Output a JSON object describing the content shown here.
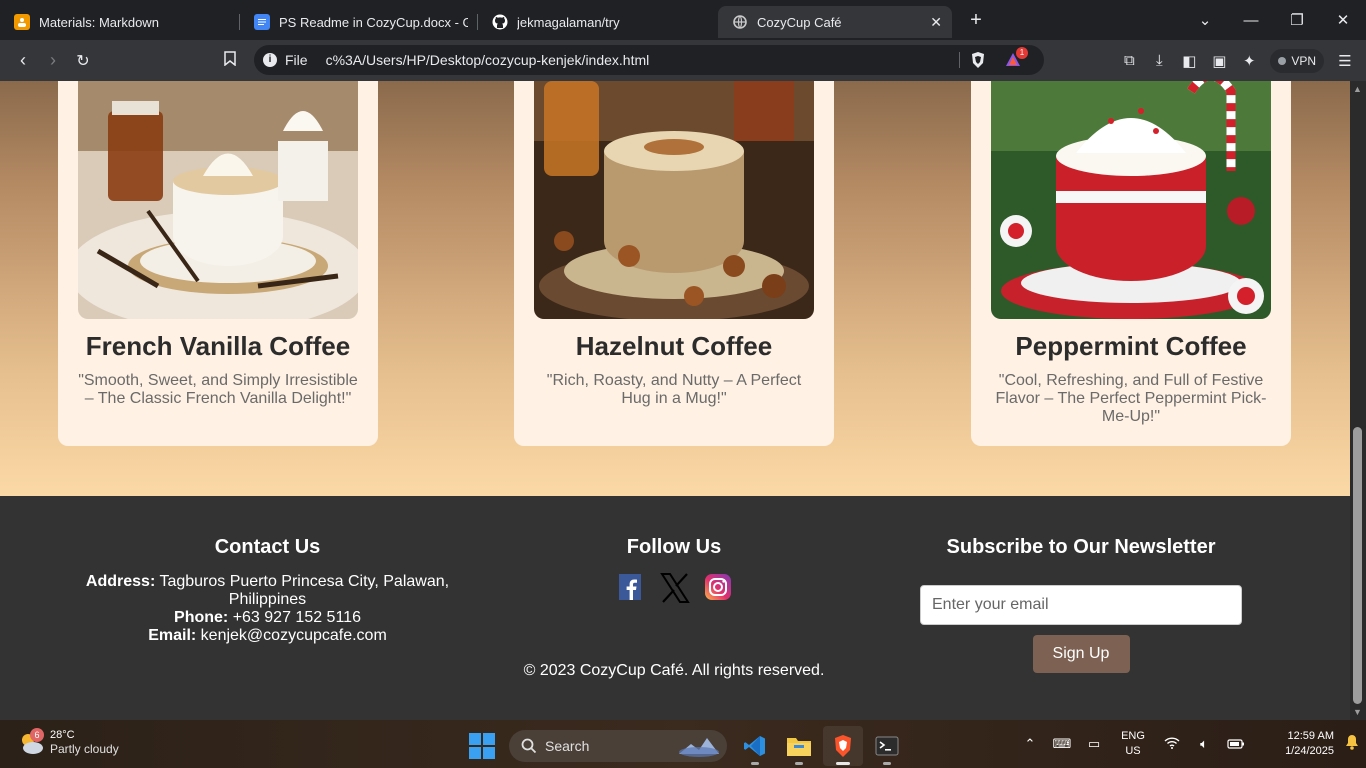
{
  "browser": {
    "tabs": [
      {
        "title": "Materials: Markdown",
        "icon": "classroom-icon",
        "color": "#f29900"
      },
      {
        "title": "PS Readme in CozyCup.docx - Goog",
        "icon": "docs-icon",
        "color": "#4285f4"
      },
      {
        "title": "jekmagalaman/try",
        "icon": "github-icon",
        "color": "#ffffff"
      },
      {
        "title": "CozyCup Café",
        "icon": "globe-icon",
        "active": true
      }
    ],
    "address": {
      "scheme": "File",
      "url": "c%3A/Users/HP/Desktop/cozycup-kenjek/index.html",
      "rewards_badge": "1"
    },
    "vpn_label": "VPN"
  },
  "products": [
    {
      "name": "French Vanilla Coffee",
      "tagline": "\"Smooth, Sweet, and Simply Irresistible – The Classic French Vanilla Delight!\""
    },
    {
      "name": "Hazelnut Coffee",
      "tagline": "\"Rich, Roasty, and Nutty – A Perfect Hug in a Mug!\""
    },
    {
      "name": "Peppermint Coffee",
      "tagline": "\"Cool, Refreshing, and Full of Festive Flavor – The Perfect Peppermint Pick-Me-Up!\""
    }
  ],
  "footer": {
    "contact": {
      "heading": "Contact Us",
      "address_label": "Address:",
      "address": "Tagburos Puerto Princesa City, Palawan, Philippines",
      "phone_label": "Phone:",
      "phone": "+63 927 152 5116",
      "email_label": "Email:",
      "email": "kenjek@cozycupcafe.com"
    },
    "follow": {
      "heading": "Follow Us",
      "icons": [
        "facebook-icon",
        "x-icon",
        "instagram-icon"
      ]
    },
    "newsletter": {
      "heading": "Subscribe to Our Newsletter",
      "placeholder": "Enter your email",
      "button": "Sign Up"
    },
    "copyright": "© 2023 CozyCup Café. All rights reserved."
  },
  "taskbar": {
    "weather": {
      "temp": "28°C",
      "condition": "Partly cloudy",
      "badge": "6"
    },
    "search_label": "Search",
    "lang_top": "ENG",
    "lang_bottom": "US",
    "time": "12:59 AM",
    "date": "1/24/2025"
  },
  "colors": {
    "accent_button": "#7d6152",
    "footer_bg": "#333333",
    "card_bg": "#fff1e3"
  }
}
